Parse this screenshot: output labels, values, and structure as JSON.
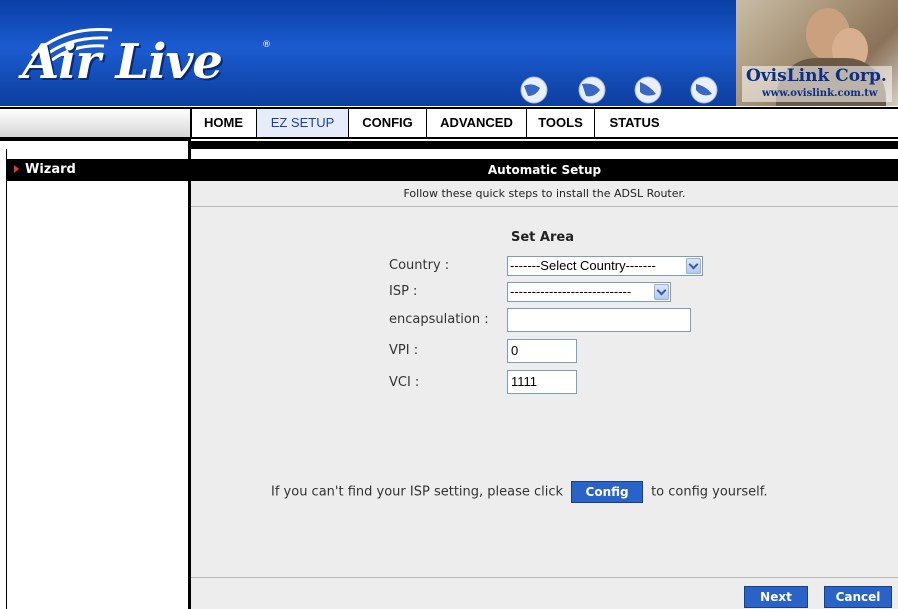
{
  "header": {
    "logo_text": "Air Live",
    "logo_reg": "®",
    "brand_name": "OvisLink Corp.",
    "brand_url": "www.ovislink.com.tw"
  },
  "nav": {
    "items": [
      {
        "label": "HOME"
      },
      {
        "label": "EZ SETUP",
        "active": true
      },
      {
        "label": "CONFIG"
      },
      {
        "label": "ADVANCED"
      },
      {
        "label": "TOOLS"
      },
      {
        "label": "STATUS"
      }
    ]
  },
  "sidebar": {
    "items": [
      {
        "label": "Wizard"
      }
    ]
  },
  "main": {
    "title": "Automatic Setup",
    "subtitle": "Follow these quick steps to install the ADSL Router.",
    "section_title": "Set Area",
    "fields": {
      "country": {
        "label": "Country :",
        "value": "-------Select Country-------"
      },
      "isp": {
        "label": "ISP :",
        "value": "----------------------------"
      },
      "encapsulation": {
        "label": "encapsulation :",
        "value": ""
      },
      "vpi": {
        "label": "VPI :",
        "value": "0"
      },
      "vci": {
        "label": "VCI :",
        "value": "1111"
      }
    },
    "help_prefix": "If you can't find your ISP setting, please click",
    "config_button": "Config",
    "help_suffix": "to config yourself.",
    "next_button": "Next",
    "cancel_button": "Cancel"
  },
  "colors": {
    "header_blue": "#1b5bd0",
    "button_blue": "#2a63c8",
    "panel_gray": "#ededed",
    "active_tab_text": "#1c3fb0"
  }
}
